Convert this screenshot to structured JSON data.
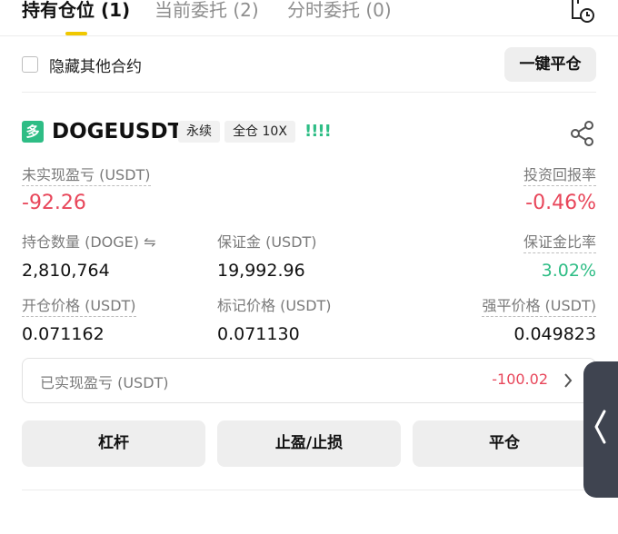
{
  "tabs": [
    {
      "label": "持有仓位 (1)",
      "active": true
    },
    {
      "label": "当前委托 (2)",
      "active": false
    },
    {
      "label": "分时委托 (0)",
      "active": false
    }
  ],
  "toolbar": {
    "hide_other_label": "隐藏其他合约",
    "hide_other_checked": false,
    "close_all_label": "一键平仓"
  },
  "position": {
    "side_badge": "多",
    "symbol": "DOGEUSDT",
    "contract_type": "永续",
    "margin_mode": "全仓 10X",
    "signal": "!!!!",
    "unrealized_pnl_label": "未实现盈亏 (USDT)",
    "unrealized_pnl": "-92.26",
    "roe_label": "投资回报率",
    "roe": "-0.46%",
    "size_label": "持仓数量 (DOGE) ⇋",
    "size": "2,810,764",
    "margin_label": "保证金 (USDT)",
    "margin": "19,992.96",
    "margin_ratio_label": "保证金比率",
    "margin_ratio": "3.02%",
    "entry_price_label": "开仓价格 (USDT)",
    "entry_price": "0.071162",
    "mark_price_label": "标记价格 (USDT)",
    "mark_price": "0.071130",
    "liq_price_label": "强平价格 (USDT)",
    "liq_price": "0.049823",
    "realized_pnl_label": "已实现盈亏 (USDT)",
    "realized_pnl": "-100.02"
  },
  "actions": {
    "leverage_label": "杠杆",
    "tpsl_label": "止盈/止损",
    "close_label": "平仓"
  },
  "colors": {
    "accent": "#f0c800",
    "long": "#2ebd85",
    "loss": "#e8465a"
  },
  "icons": {
    "history": "history-icon",
    "share": "share-icon",
    "chevron": "chevron-right-icon",
    "handle": "chevron-left-icon"
  }
}
